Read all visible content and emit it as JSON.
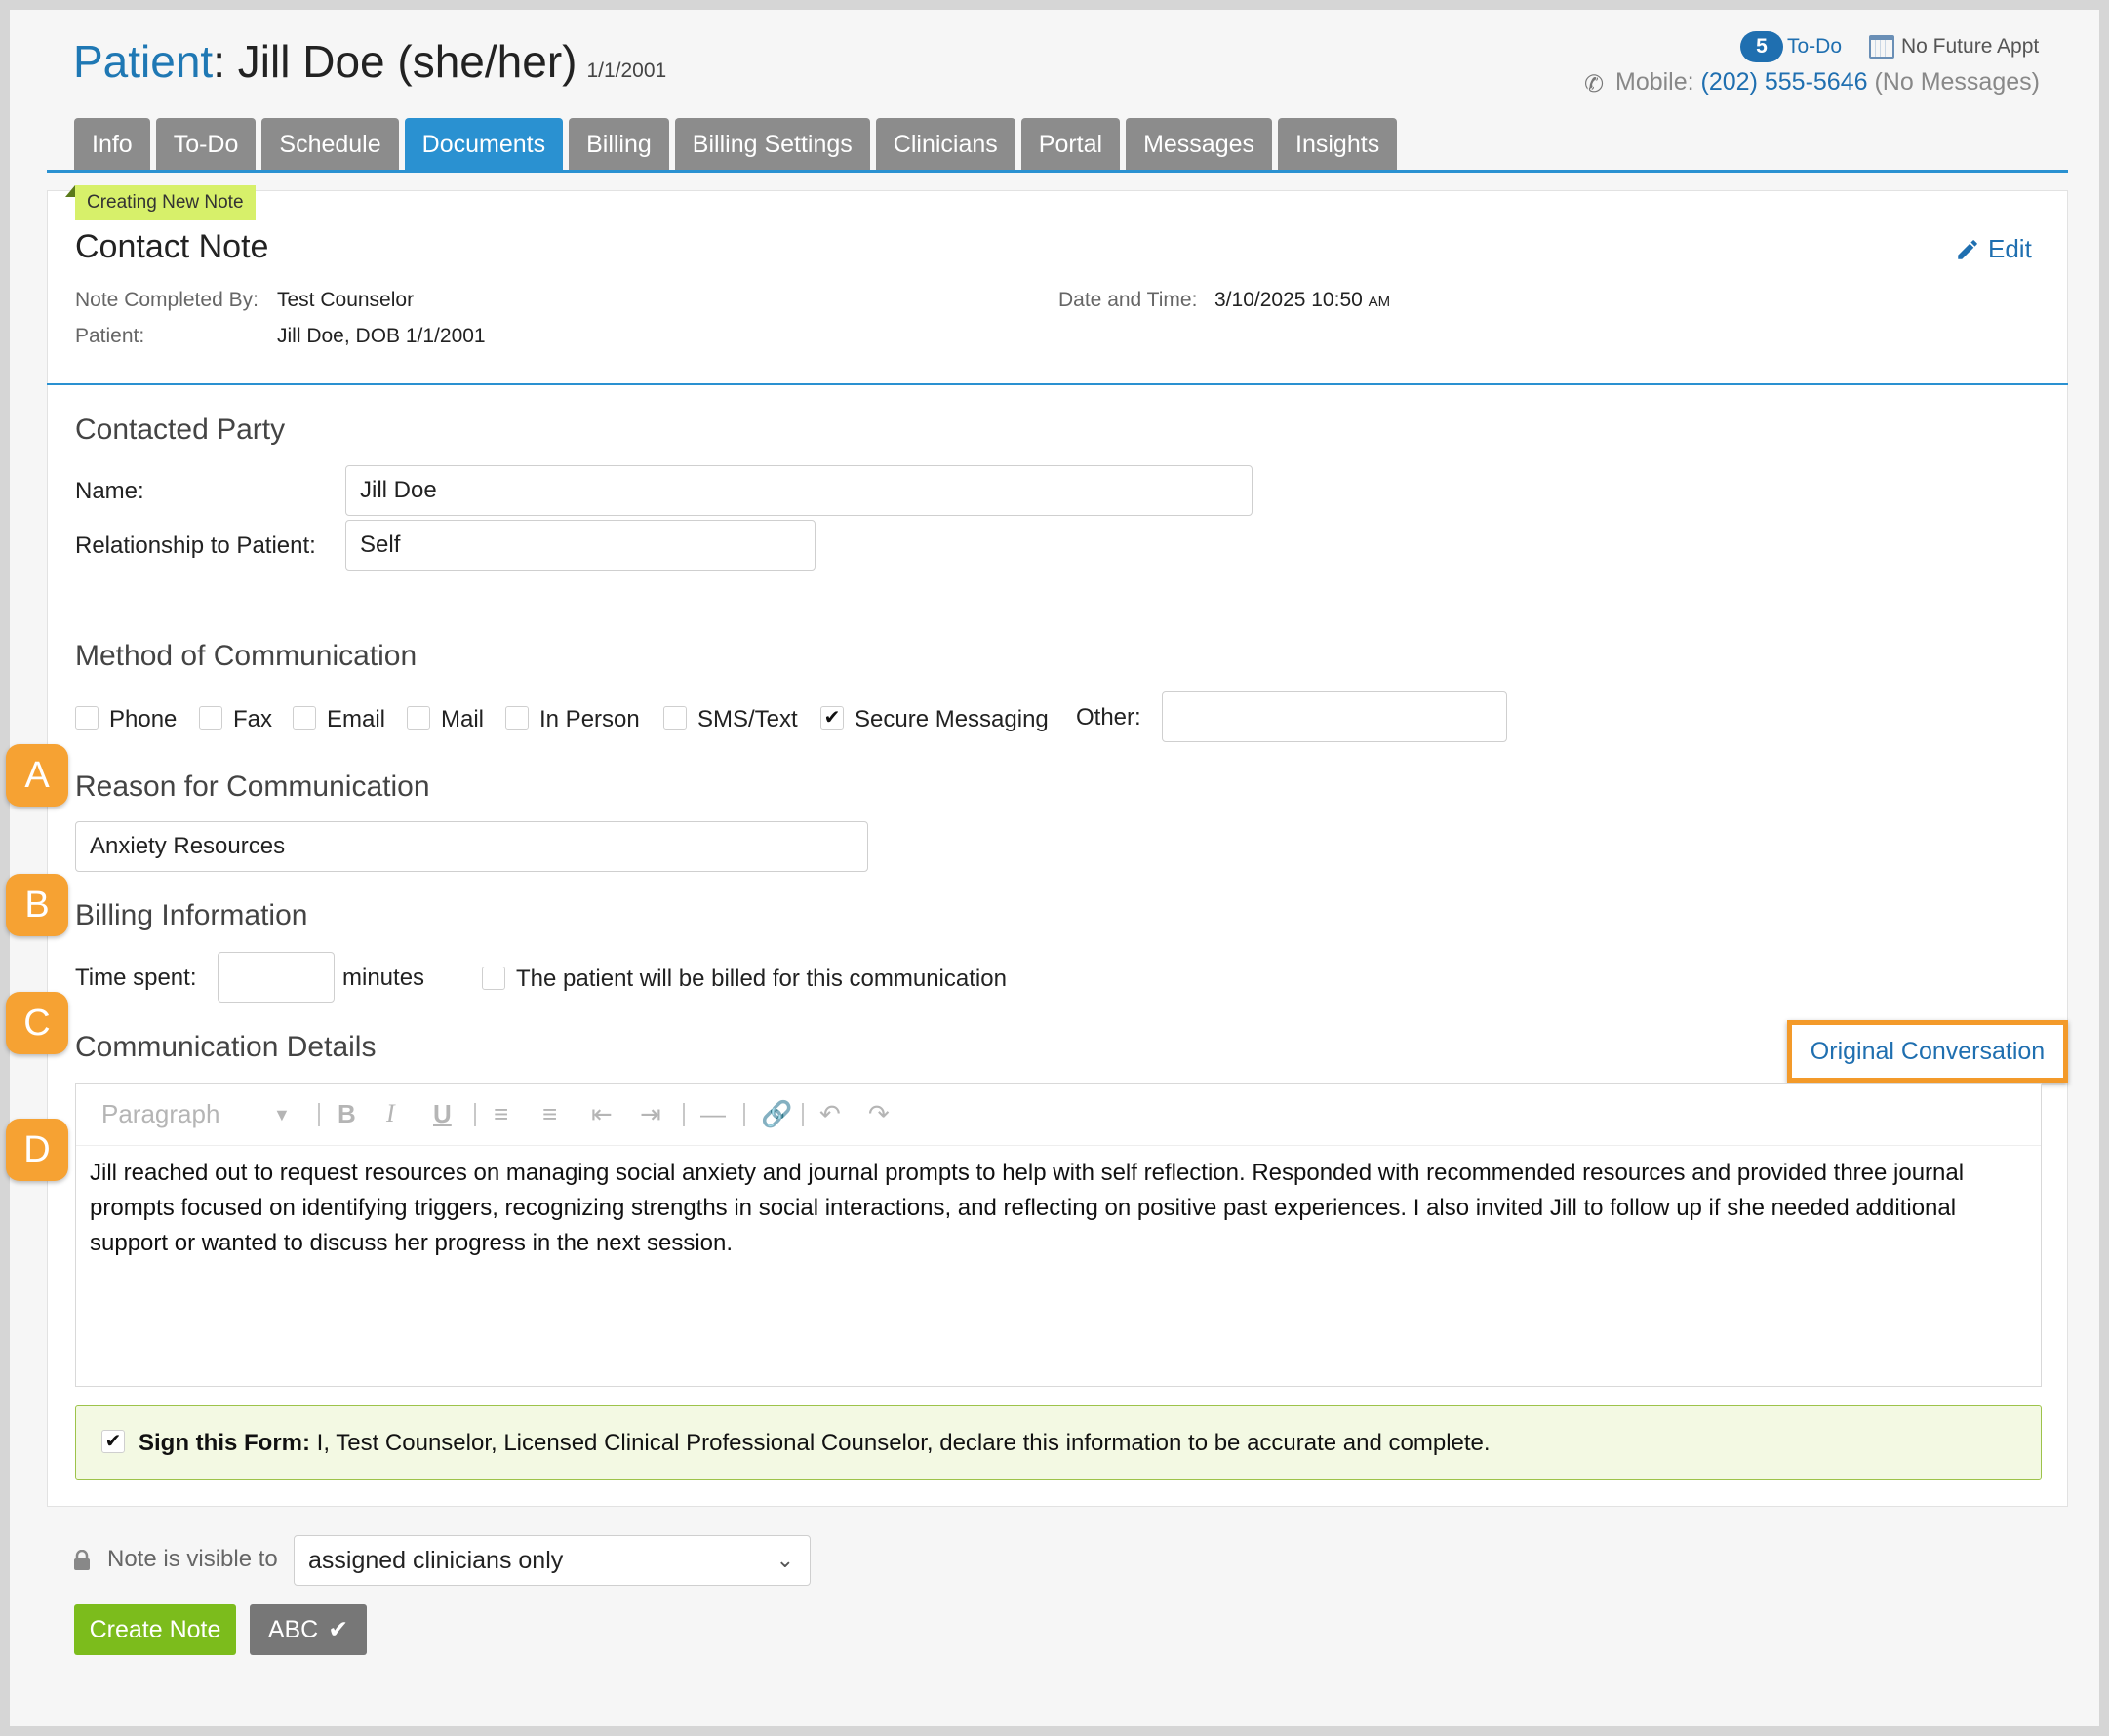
{
  "header": {
    "patient_label": "Patient",
    "patient_name": ": Jill Doe (she/her)",
    "dob": "1/1/2001",
    "todo_count": "5",
    "todo_label": "To-Do",
    "future_appt": "No Future Appt",
    "mobile_label": "Mobile:",
    "mobile_number": "(202) 555-5646",
    "mobile_status": "(No Messages)"
  },
  "tabs": [
    {
      "label": "Info"
    },
    {
      "label": "To-Do"
    },
    {
      "label": "Schedule"
    },
    {
      "label": "Documents",
      "active": true
    },
    {
      "label": "Billing"
    },
    {
      "label": "Billing Settings"
    },
    {
      "label": "Clinicians"
    },
    {
      "label": "Portal"
    },
    {
      "label": "Messages"
    },
    {
      "label": "Insights"
    }
  ],
  "note": {
    "status_tag": "Creating New Note",
    "title": "Contact Note",
    "edit_label": "Edit",
    "completed_by_label": "Note Completed By:",
    "completed_by": "Test Counselor",
    "patient_label": "Patient:",
    "patient_value": "Jill Doe, DOB 1/1/2001",
    "datetime_label": "Date and Time:",
    "datetime_value": "3/10/2025 10:50",
    "datetime_ampm": "AM"
  },
  "contacted_party": {
    "heading": "Contacted Party",
    "name_label": "Name:",
    "name_value": "Jill Doe",
    "relationship_label": "Relationship to Patient:",
    "relationship_value": "Self"
  },
  "method": {
    "heading": "Method of Communication",
    "options": [
      {
        "label": "Phone",
        "checked": false
      },
      {
        "label": "Fax",
        "checked": false
      },
      {
        "label": "Email",
        "checked": false
      },
      {
        "label": "Mail",
        "checked": false
      },
      {
        "label": "In Person",
        "checked": false
      },
      {
        "label": "SMS/Text",
        "checked": false
      },
      {
        "label": "Secure Messaging",
        "checked": true
      }
    ],
    "other_label": "Other:",
    "other_value": ""
  },
  "reason": {
    "heading": "Reason for Communication",
    "value": "Anxiety Resources"
  },
  "billing": {
    "heading": "Billing Information",
    "time_label": "Time spent:",
    "time_value": "",
    "minutes_label": "minutes",
    "billed_label": "The patient will be billed for this communication",
    "billed_checked": false
  },
  "details": {
    "heading": "Communication Details",
    "original_conversation": "Original Conversation",
    "toolbar_format": "Paragraph",
    "body": "Jill reached out to request resources on managing social anxiety and journal prompts to help with self reflection. Responded with recommended resources and provided three journal prompts focused on identifying triggers, recognizing strengths in social interactions, and reflecting on positive past experiences. I also invited Jill to follow up if she needed additional support or wanted to discuss her progress in the next session."
  },
  "sign": {
    "label": "Sign this Form:",
    "text": " I, Test Counselor, Licensed Clinical Professional Counselor, declare this information to be accurate and complete.",
    "checked": true
  },
  "visibility": {
    "label": "Note is visible to",
    "selected": "assigned clinicians only"
  },
  "actions": {
    "create_label": "Create Note",
    "spell_label": "ABC"
  },
  "markers": [
    "A",
    "B",
    "C",
    "D"
  ],
  "colors": {
    "accent": "#2a91d1",
    "tab_inactive": "#8c8c8c",
    "marker": "#f6a233",
    "create_button": "#7cbc1c",
    "tag": "#d7f06a"
  }
}
